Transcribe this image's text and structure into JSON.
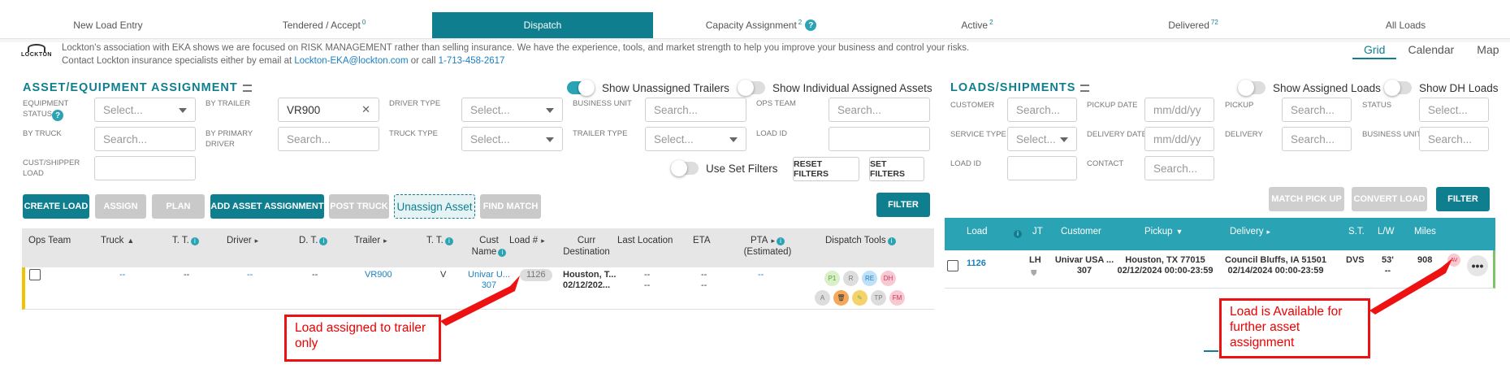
{
  "tabs": [
    {
      "label": "New Load Entry",
      "badge": ""
    },
    {
      "label": "Tendered / Accept",
      "badge": "0"
    },
    {
      "label": "Dispatch",
      "badge": ""
    },
    {
      "label": "Capacity Assignment",
      "badge": "2"
    },
    {
      "label": "Active",
      "badge": "2"
    },
    {
      "label": "Delivered",
      "badge": "72"
    },
    {
      "label": "All Loads",
      "badge": ""
    }
  ],
  "logo": {
    "text": "LOCKTON"
  },
  "insurance": {
    "text": "Lockton's association with EKA shows we are focused on RISK MANAGEMENT rather than selling insurance. We have the experience, tools, and market strength to help you improve your business and control your risks. Contact Lockton insurance specialists either by email at ",
    "email": "Lockton-EKA@lockton.com",
    "mid": " or call ",
    "phone": "1-713-458-2617"
  },
  "views": [
    "Grid",
    "Calendar",
    "Map"
  ],
  "left": {
    "title": "ASSET/EQUIPMENT ASSIGNMENT",
    "toggles": {
      "unassigned_trailers": "Show Unassigned Trailers",
      "individual_assets": "Show Individual Assigned Assets",
      "use_set_filters": "Use Set Filters"
    },
    "labels": {
      "equipment_status": "EQUIPMENT STATUS",
      "by_trailer": "BY TRAILER",
      "driver_type": "DRIVER TYPE",
      "business_unit": "BUSINESS UNIT",
      "ops_team": "OPS TEAM",
      "by_truck": "BY TRUCK",
      "by_primary_driver": "BY PRIMARY DRIVER",
      "truck_type": "TRUCK TYPE",
      "trailer_type": "TRAILER TYPE",
      "load_id": "LOAD ID",
      "cust_shipper_load": "CUST/SHIPPER LOAD"
    },
    "ph": {
      "select": "Select...",
      "search": "Search..."
    },
    "trailer_value": "VR900",
    "buttons": {
      "reset": "RESET FILTERS",
      "set": "SET FILTERS",
      "create": "CREATE LOAD",
      "assign": "ASSIGN",
      "plan": "PLAN",
      "add_asset": "ADD ASSET ASSIGNMENT",
      "post_truck": "POST TRUCK",
      "unassign": "Unassign Asset",
      "find_match": "FIND MATCH",
      "filter": "FILTER"
    },
    "columns": {
      "ops_team": "Ops Team",
      "truck": "Truck",
      "tt": "T. T.",
      "driver": "Driver",
      "dt": "D. T.",
      "trailer": "Trailer",
      "tt2": "T. T.",
      "cust1": "Cust",
      "cust2": "Name",
      "load": "Load #",
      "curr1": "Curr",
      "curr2": "Destination",
      "last_loc": "Last Location",
      "eta": "ETA",
      "pta1": "PTA",
      "pta2": "(Estimated)",
      "tools": "Dispatch Tools"
    },
    "row": {
      "truck": "--",
      "tt": "--",
      "driver": "--",
      "dt": "--",
      "trailer": "VR900",
      "tt2": "V",
      "cust1": "Univar U...",
      "cust2": "307",
      "load": "1126",
      "curr1": "Houston, T...",
      "curr2": "02/12/202...",
      "last1": "--",
      "last2": "--",
      "eta1": "--",
      "eta2": "--",
      "pta": "--"
    },
    "tools": [
      "P1",
      "R",
      "RE",
      "DH",
      "A",
      "",
      "",
      "TP",
      "FM"
    ]
  },
  "right": {
    "title": "LOADS/SHIPMENTS",
    "toggles": {
      "assigned": "Show Assigned Loads",
      "dh": "Show DH Loads"
    },
    "labels": {
      "customer": "CUSTOMER",
      "pickup_date": "PICKUP DATE",
      "pickup": "PICKUP",
      "status": "STATUS",
      "service_type": "SERVICE TYPE",
      "delivery_date": "DELIVERY DATE",
      "delivery": "DELIVERY",
      "business_unit": "BUSINESS UNIT",
      "load_id": "LOAD ID",
      "contact": "CONTACT"
    },
    "ph": {
      "search": "Search...",
      "date": "mm/dd/yy",
      "select": "Select...",
      "select_short": "Select..."
    },
    "buttons": {
      "match": "MATCH PICK UP",
      "convert": "CONVERT LOAD",
      "filter": "FILTER"
    },
    "columns": {
      "load": "Load",
      "jt": "JT",
      "customer": "Customer",
      "pickup": "Pickup",
      "delivery": "Delivery",
      "st": "S.T.",
      "lw": "L/W",
      "miles": "Miles"
    },
    "row": {
      "load": "1126",
      "jt": "LH",
      "cust1": "Univar USA ...",
      "cust2": "307",
      "pick1": "Houston, TX 77015",
      "pick2": "02/12/2024 00:00-23:59",
      "del1": "Council Bluffs, IA 51501",
      "del2": "02/14/2024 00:00-23:59",
      "st": "DVS",
      "lw1": "53'",
      "lw2": "--",
      "miles": "908",
      "badge": "AV"
    }
  },
  "callouts": {
    "left": "Load assigned to trailer only",
    "right": "Load is Available for further asset assignment"
  }
}
